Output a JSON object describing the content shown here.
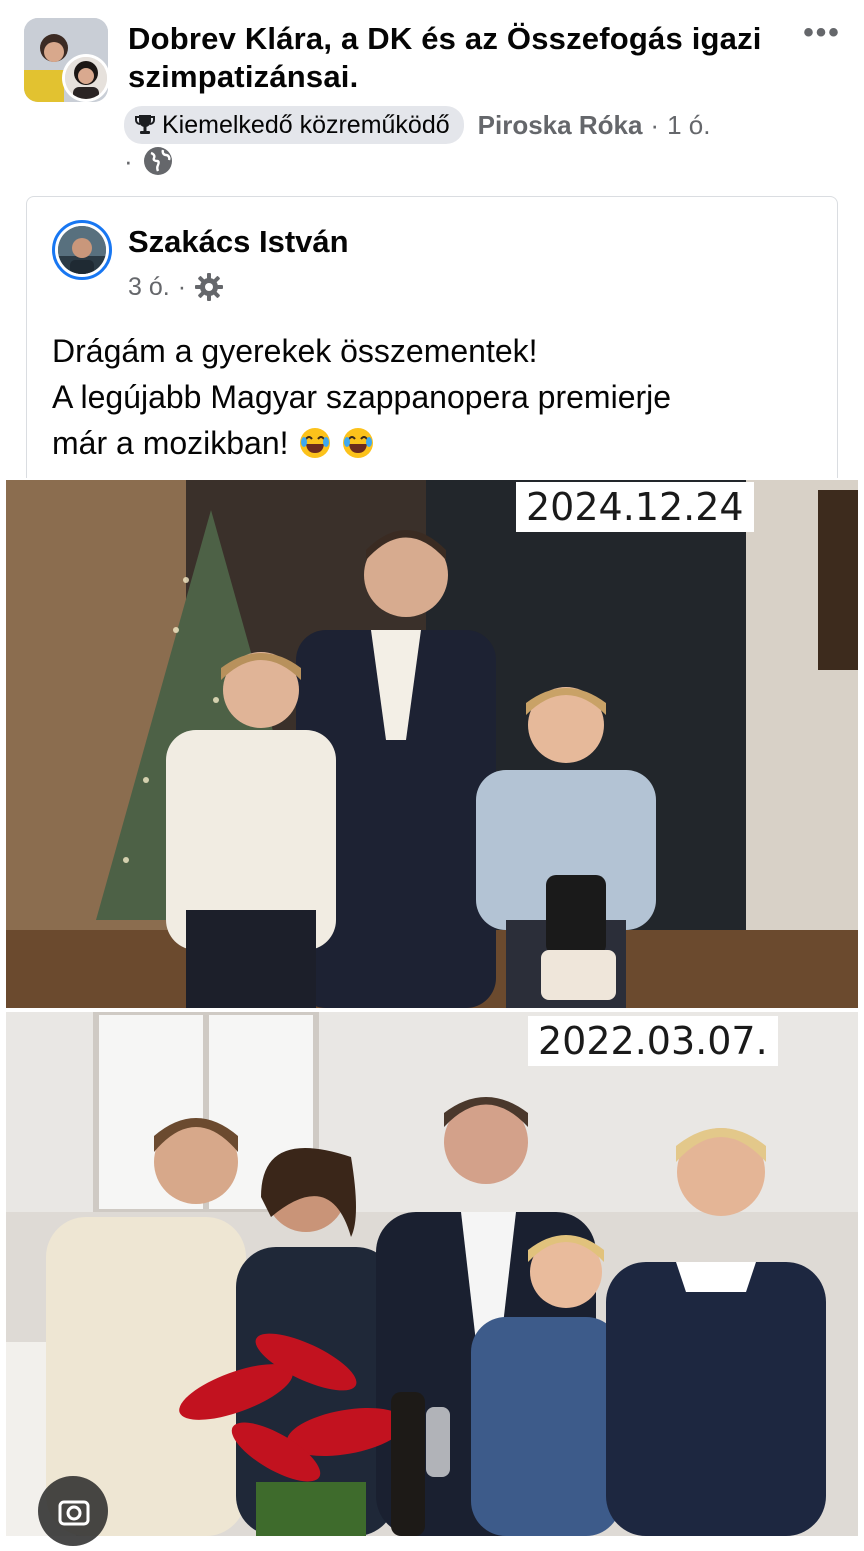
{
  "group": {
    "name": "Dobrev Klára, a DK és az Összefogás igazi szimpatizánsai.",
    "badge": "Kiemelkedő közreműködő",
    "author": "Piroska Róka",
    "time": "1 ó."
  },
  "post": {
    "author": "Szakács István",
    "time": "3 ó.",
    "text_line1": "Drágám a gyerekek összementek!",
    "text_line2": "A legújabb Magyar szappanopera premierje",
    "text_line3": "már a mozikban!"
  },
  "photos": [
    {
      "date": "2024.12.24"
    },
    {
      "date": "2022.03.07."
    }
  ],
  "icons": [
    "more-icon",
    "trophy-icon",
    "globe-icon",
    "gear-icon",
    "laughing-emoji-icon",
    "camera-icon"
  ],
  "colors": {
    "accent": "#1877f2",
    "secondary_text": "#65676b",
    "badge_bg": "#e4e6eb"
  }
}
